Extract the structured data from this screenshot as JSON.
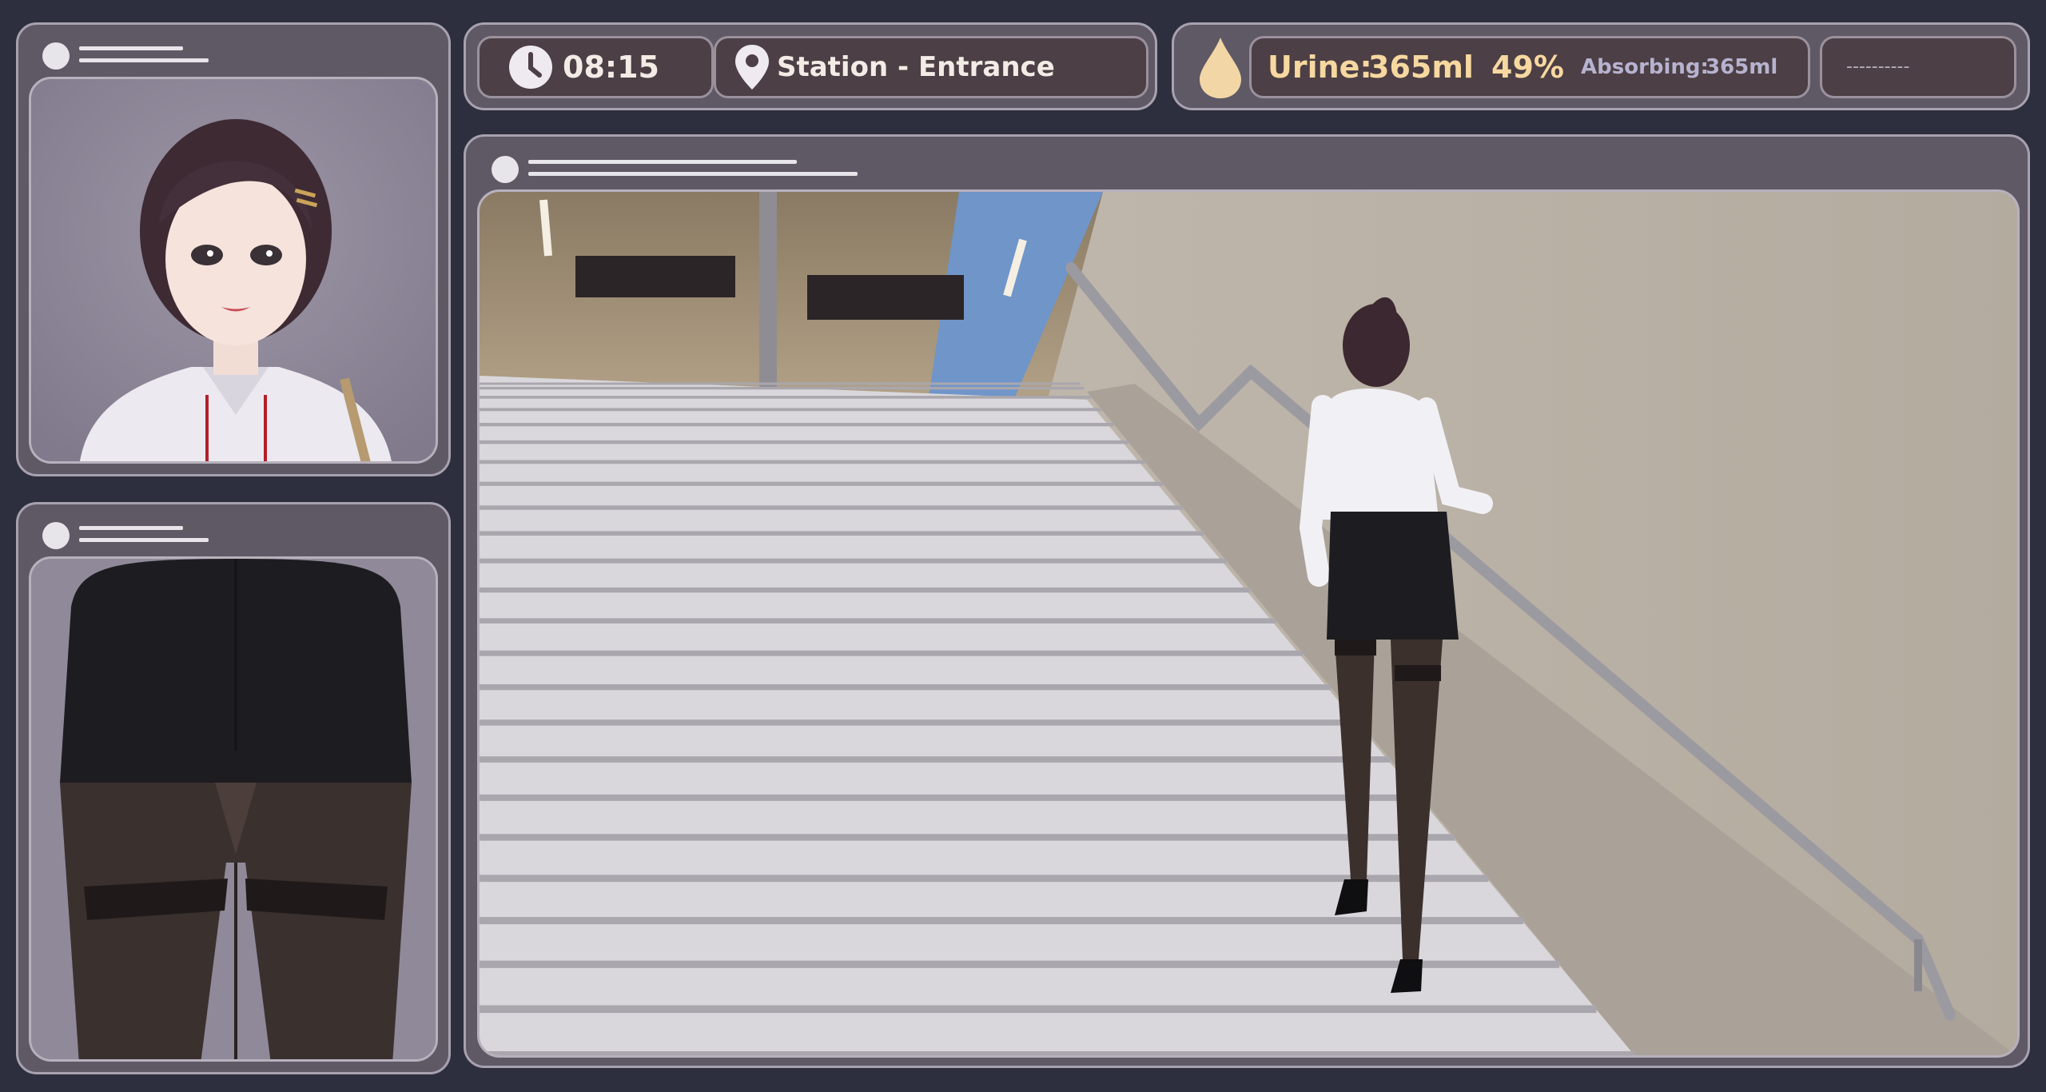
{
  "hud": {
    "time": "08:15",
    "location": "Station - Entrance",
    "urine_label": "Urine:",
    "urine_amount": "365ml",
    "urine_percent": "49%",
    "absorbing_label": "Absorbing:",
    "absorbing_amount": "365ml",
    "empty_slot": "----------"
  },
  "icons": {
    "clock": "clock-icon",
    "location": "map-pin-icon",
    "urine": "droplet-icon"
  },
  "colors": {
    "background": "#2d2f3e",
    "panel": "#5f5966",
    "panel_border": "#a8a1b0",
    "urine_accent": "#f7d8a0",
    "droplet": "#f3d6a6",
    "absorbing": "#b6b3cf"
  }
}
